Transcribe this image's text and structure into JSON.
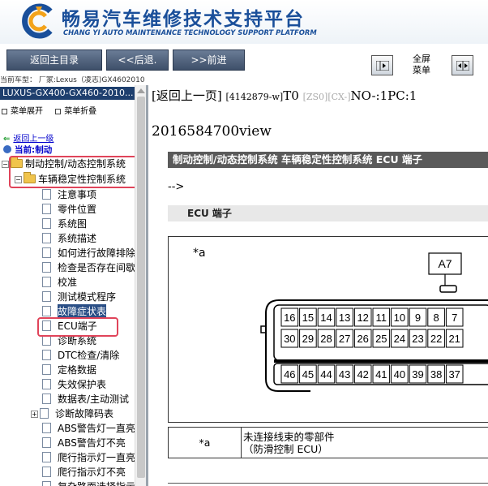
{
  "header": {
    "title": "畅易汽车维修技术支持平台",
    "subtitle": "CHANG YI AUTO MAINTENANCE TECHNOLOGY SUPPORT PLATFORM"
  },
  "toolbar": {
    "home": "返回主目录",
    "back": "<<后退.",
    "forward": ">>前进",
    "fullscreen_line1": "全屏",
    "fullscreen_line2": "菜单"
  },
  "model_line": "当前车型：  厂家:Lexus（凌志)GX4602010",
  "sidebar": {
    "model": "LUXUS-GX400-GX460-2010...",
    "expand": "菜单展开",
    "collapse": "菜单折叠",
    "return_up": "返回上一级",
    "current": "当前:制动",
    "folders": [
      {
        "label": "制动控制/动态控制系统"
      },
      {
        "label": "车辆稳定性控制系统"
      }
    ],
    "items": [
      {
        "label": "注意事项"
      },
      {
        "label": "零件位置"
      },
      {
        "label": "系统图"
      },
      {
        "label": "系统描述"
      },
      {
        "label": "如何进行故障排除"
      },
      {
        "label": "检查是否存在间歇性故障"
      },
      {
        "label": "校准"
      },
      {
        "label": "测试模式程序"
      },
      {
        "label": "故障症状表"
      },
      {
        "label": "ECU端子"
      },
      {
        "label": "诊断系统"
      },
      {
        "label": "DTC检查/清除"
      },
      {
        "label": "定格数据"
      },
      {
        "label": "失效保护表"
      },
      {
        "label": "数据表/主动测试"
      },
      {
        "label": "诊断故障码表"
      },
      {
        "label": "ABS警告灯一直亮起"
      },
      {
        "label": "ABS警告灯不亮"
      },
      {
        "label": "爬行指示灯一直亮起"
      },
      {
        "label": "爬行指示灯不亮"
      },
      {
        "label": "复杂路面选择指示灯"
      }
    ]
  },
  "content": {
    "return_prev": "返回上一页",
    "doc_code": "[4142879-w]",
    "t0": "T0",
    "zs0": "[ZS0]",
    "cx": "[CX-]",
    "no_pc": "NO-:1PC:1",
    "view_id": "2016584700view",
    "title": "制动控制/动态控制系统  车辆稳定性控制系统  ECU 端子",
    "arrow": "-->",
    "section": "ECU 端子",
    "diagram": {
      "label_a": "*a",
      "connector": "A7",
      "row1": [
        "16",
        "15",
        "14",
        "13",
        "12",
        "11",
        "10",
        "9",
        "8",
        "7"
      ],
      "row2": [
        "30",
        "29",
        "28",
        "27",
        "26",
        "25",
        "24",
        "23",
        "22",
        "21"
      ],
      "row3": [
        "46",
        "45",
        "44",
        "43",
        "42",
        "41",
        "40",
        "39",
        "38",
        "37"
      ]
    },
    "legend": {
      "key": "*a",
      "line1": "未连接线束的零部件",
      "line2": "（防滑控制 ECU）"
    }
  }
}
